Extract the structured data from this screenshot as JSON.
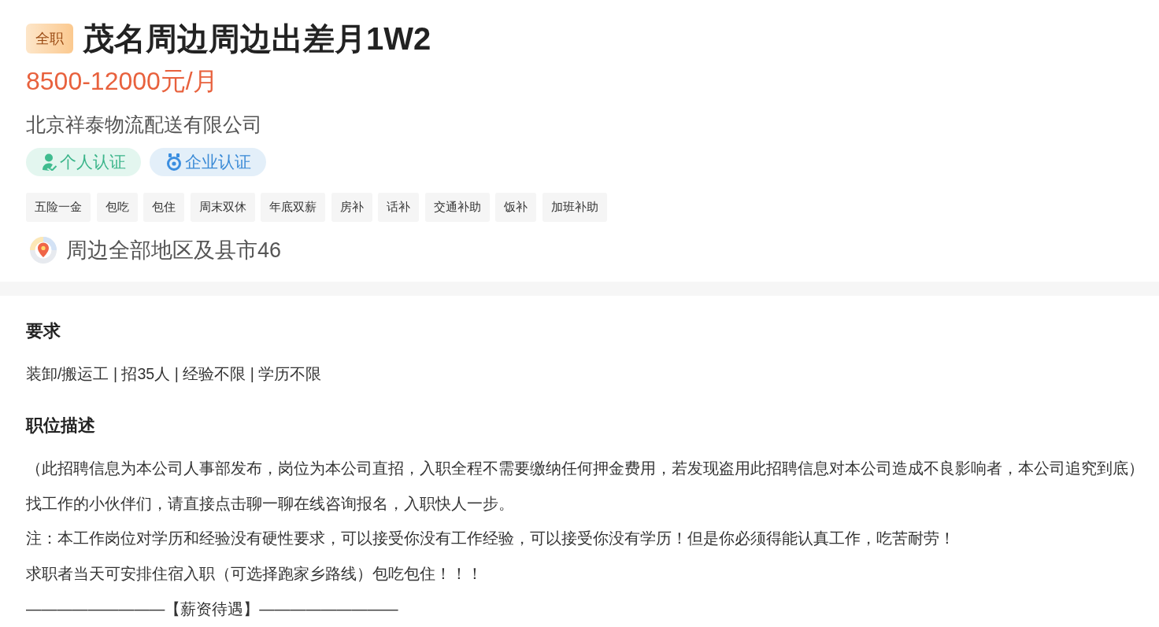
{
  "job": {
    "type_badge": "全职",
    "title": "茂名周边周边出差月1W2",
    "salary": "8500-12000元/月",
    "company": "北京祥泰物流配送有限公司",
    "certifications": [
      {
        "kind": "personal",
        "label": "个人认证"
      },
      {
        "kind": "enterprise",
        "label": "企业认证"
      }
    ],
    "benefits": [
      "五险一金",
      "包吃",
      "包住",
      "周末双休",
      "年底双薪",
      "房补",
      "话补",
      "交通补助",
      "饭补",
      "加班补助"
    ],
    "location": "周边全部地区及县市46"
  },
  "sections": [
    {
      "heading": "要求",
      "paragraphs": [
        "装卸/搬运工 | 招35人 | 经验不限 | 学历不限"
      ]
    },
    {
      "heading": "职位描述",
      "paragraphs": [
        "（此招聘信息为本公司人事部发布，岗位为本公司直招，入职全程不需要缴纳任何押金费用，若发现盗用此招聘信息对本公司造成不良影响者，本公司追究到底）",
        "找工作的小伙伴们，请直接点击聊一聊在线咨询报名，入职快人一步。",
        "注：本工作岗位对学历和经验没有硬性要求，可以接受你没有工作经验，可以接受你没有学历！但是你必须得能认真工作，吃苦耐劳！",
        "求职者当天可安排住宿入职（可选择跑家乡路线）包吃包住！！！",
        "—————————【薪资待遇】—————————"
      ]
    }
  ]
}
